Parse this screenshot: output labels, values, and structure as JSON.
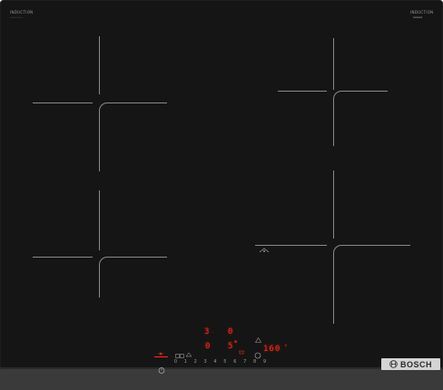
{
  "brand": {
    "top_left_label": "INDUCTION",
    "top_left_sublabel": "••••••••",
    "top_right_label": "INDUCTION",
    "top_right_sublabel": "▪▪▪▪▪",
    "logo_text": "BOSCH"
  },
  "display": {
    "timer_minutes": "3",
    "timer_seconds": "0",
    "zone_level": "0",
    "zone_sub": "5",
    "power_readout": "160",
    "power_unit": "°"
  },
  "touch_scale": [
    "0",
    "1",
    "2",
    "3",
    "4",
    "5",
    "6",
    "7",
    "8",
    "9"
  ],
  "colors": {
    "glass": "#151515",
    "zone_marks": "#8a8a8a",
    "display_red": "#ff2a1a",
    "logo_plate": "#d4d4d4"
  }
}
